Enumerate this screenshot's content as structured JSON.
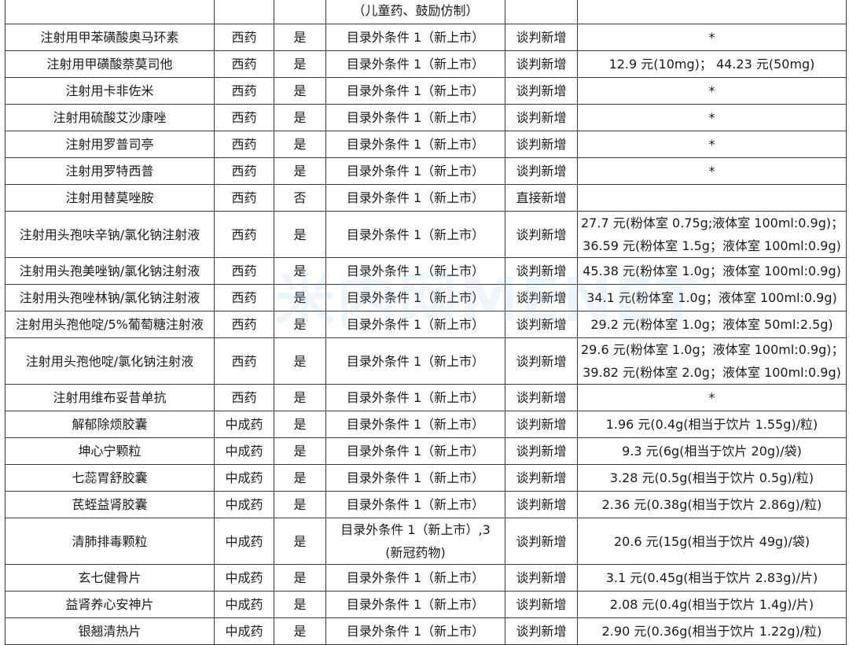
{
  "watermark": "米内网MENET",
  "rows": [
    {
      "name": "",
      "type": "",
      "otc": "",
      "category": "（儿童药、鼓励仿制）",
      "method": "",
      "price": ""
    },
    {
      "name": "注射用甲苯磺酸奥马环素",
      "type": "西药",
      "otc": "是",
      "category": "目录外条件 1（新上市）",
      "method": "谈判新增",
      "price": "*"
    },
    {
      "name": "注射用甲磺酸萘莫司他",
      "type": "西药",
      "otc": "是",
      "category": "目录外条件 1（新上市）",
      "method": "谈判新增",
      "price": "12.9 元(10mg)；  44.23 元(50mg)"
    },
    {
      "name": "注射用卡非佐米",
      "type": "西药",
      "otc": "是",
      "category": "目录外条件 1（新上市）",
      "method": "谈判新增",
      "price": "*"
    },
    {
      "name": "注射用硫酸艾沙康唑",
      "type": "西药",
      "otc": "是",
      "category": "目录外条件 1（新上市）",
      "method": "谈判新增",
      "price": "*"
    },
    {
      "name": "注射用罗普司亭",
      "type": "西药",
      "otc": "是",
      "category": "目录外条件 1（新上市）",
      "method": "谈判新增",
      "price": "*"
    },
    {
      "name": "注射用罗特西普",
      "type": "西药",
      "otc": "是",
      "category": "目录外条件 1（新上市）",
      "method": "谈判新增",
      "price": "*"
    },
    {
      "name": "注射用替莫唑胺",
      "type": "西药",
      "otc": "否",
      "category": "目录外条件 1（新上市）",
      "method": "直接新增",
      "price": ""
    },
    {
      "name": "注射用头孢呋辛钠/氯化钠注射液",
      "type": "西药",
      "otc": "是",
      "category": "目录外条件 1（新上市）",
      "method": "谈判新增",
      "price": "27.7 元(粉体室 0.75g;液体室  100ml:0.9g)；",
      "price2": "36.59 元(粉体室 1.5g；液体室  100ml:0.9g)"
    },
    {
      "name": "注射用头孢美唑钠/氯化钠注射液",
      "type": "西药",
      "otc": "是",
      "category": "目录外条件 1（新上市）",
      "method": "谈判新增",
      "price": "45.38 元(粉体室 1.0g；液体室  100ml:0.9g)"
    },
    {
      "name": "注射用头孢唑林钠/氯化钠注射液",
      "type": "西药",
      "otc": "是",
      "category": "目录外条件 1（新上市）",
      "method": "谈判新增",
      "price": "34.1 元(粉体室 1.0g；液体室  100ml:0.9g)"
    },
    {
      "name": "注射用头孢他啶/5%葡萄糖注射液",
      "type": "西药",
      "otc": "是",
      "category": "目录外条件 1（新上市）",
      "method": "谈判新增",
      "price": "29.2 元(粉体室 1.0g；液体室  50ml:2.5g)"
    },
    {
      "name": "注射用头孢他啶/氯化钠注射液",
      "type": "西药",
      "otc": "是",
      "category": "目录外条件 1（新上市）",
      "method": "谈判新增",
      "price": "29.6 元(粉体室 1.0g；液体室  100ml:0.9g)；",
      "price2": "39.82 元(粉体室 2.0g；液体室  100ml:0.9g)"
    },
    {
      "name": "注射用维布妥昔单抗",
      "type": "西药",
      "otc": "是",
      "category": "目录外条件 1（新上市）",
      "method": "谈判新增",
      "price": "*"
    },
    {
      "name": "解郁除烦胶囊",
      "type": "中成药",
      "otc": "是",
      "category": "目录外条件 1（新上市）",
      "method": "谈判新增",
      "price": "1.96 元(0.4g(相当于饮片 1.55g)/粒)"
    },
    {
      "name": "坤心宁颗粒",
      "type": "中成药",
      "otc": "是",
      "category": "目录外条件 1（新上市）",
      "method": "谈判新增",
      "price": "9.3 元(6g(相当于饮片 20g)/袋)"
    },
    {
      "name": "七蕊胃舒胶囊",
      "type": "中成药",
      "otc": "是",
      "category": "目录外条件 1（新上市）",
      "method": "谈判新增",
      "price": "3.28 元(0.5g(相当于饮片 0.5g)/粒)"
    },
    {
      "name": "芪蛭益肾胶囊",
      "type": "中成药",
      "otc": "是",
      "category": "目录外条件 1（新上市）",
      "method": "谈判新增",
      "price": "2.36 元(0.38g(相当于饮片 2.86g)/粒)"
    },
    {
      "name": "清肺排毒颗粒",
      "type": "中成药",
      "otc": "是",
      "category": "目录外条件 1（新上市）,3",
      "category2": "(新冠药物)",
      "method": "谈判新增",
      "price": "20.6 元(15g(相当于饮片 49g)/袋)"
    },
    {
      "name": "玄七健骨片",
      "type": "中成药",
      "otc": "是",
      "category": "目录外条件 1（新上市）",
      "method": "谈判新增",
      "price": "3.1 元(0.45g(相当于饮片 2.83g)/片)"
    },
    {
      "name": "益肾养心安神片",
      "type": "中成药",
      "otc": "是",
      "category": "目录外条件 1（新上市）",
      "method": "谈判新增",
      "price": "2.08 元(0.4g(相当于饮片 1.4g)/片)"
    },
    {
      "name": "银翘清热片",
      "type": "中成药",
      "otc": "是",
      "category": "目录外条件 1（新上市）",
      "method": "谈判新增",
      "price": "2.90 元(0.36g(相当于饮片 1.22g)/粒)"
    }
  ]
}
